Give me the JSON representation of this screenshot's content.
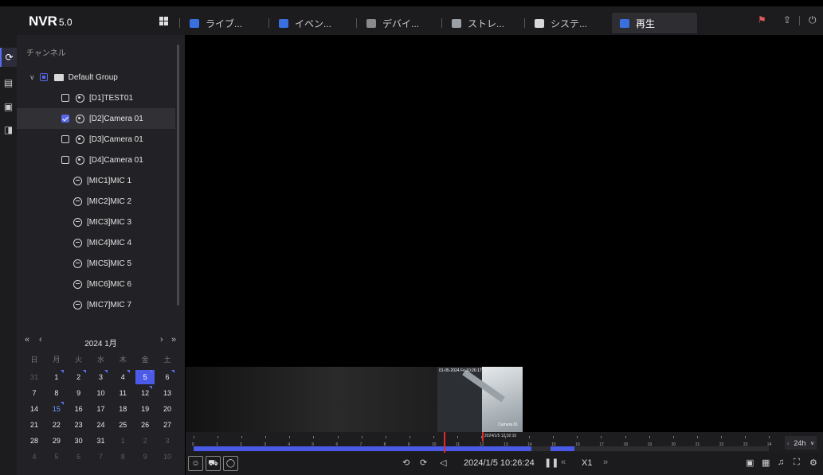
{
  "app": {
    "logo": "NVR",
    "version": "5.0"
  },
  "tabs": [
    {
      "label": "ライブ...",
      "icon": "live-view-icon",
      "color": "#3a6fe0"
    },
    {
      "label": "イベン...",
      "icon": "event-icon",
      "color": "#3a6fe0"
    },
    {
      "label": "デバイ...",
      "icon": "device-camera-icon",
      "color": "#8a8a8a"
    },
    {
      "label": "ストレ...",
      "icon": "storage-icon",
      "color": "#9aa0a6"
    },
    {
      "label": "システ...",
      "icon": "gear-icon",
      "color": "#d8d8d8"
    },
    {
      "label": "再生",
      "icon": "playback-icon",
      "color": "#3a6fe0",
      "active": true
    }
  ],
  "channel_panel": {
    "title": "チャンネル",
    "group": "Default Group",
    "channels": [
      {
        "label": "[D1]TEST01",
        "checked": false
      },
      {
        "label": "[D2]Camera 01",
        "checked": true
      },
      {
        "label": "[D3]Camera 01",
        "checked": false
      },
      {
        "label": "[D4]Camera 01",
        "checked": false
      }
    ],
    "mics": [
      "[MIC1]MIC 1",
      "[MIC2]MIC 2",
      "[MIC3]MIC 3",
      "[MIC4]MIC 4",
      "[MIC5]MIC 5",
      "[MIC6]MIC 6",
      "[MIC7]MIC 7"
    ]
  },
  "calendar": {
    "title": "2024 1月",
    "weekdays": [
      "日",
      "月",
      "火",
      "水",
      "木",
      "金",
      "土"
    ],
    "weeks": [
      [
        "31",
        "1",
        "2",
        "3",
        "4",
        "5",
        "6"
      ],
      [
        "7",
        "8",
        "9",
        "10",
        "11",
        "12",
        "13"
      ],
      [
        "14",
        "15",
        "16",
        "17",
        "18",
        "19",
        "20"
      ],
      [
        "21",
        "22",
        "23",
        "24",
        "25",
        "26",
        "27"
      ],
      [
        "28",
        "29",
        "30",
        "31",
        "1",
        "2",
        "3"
      ],
      [
        "4",
        "5",
        "6",
        "7",
        "8",
        "9",
        "10"
      ]
    ],
    "selected_day": "5",
    "current_day": "15",
    "recorded_days": [
      "1",
      "2",
      "3",
      "4",
      "5",
      "6",
      "12",
      "15"
    ]
  },
  "preview": {
    "osd": "01-05-2024 Fri 10:26:17",
    "camera_label": "Camera 01"
  },
  "timeline": {
    "hours": [
      "0",
      "1",
      "2",
      "3",
      "4",
      "5",
      "6",
      "7",
      "8",
      "9",
      "10",
      "11",
      "12",
      "13",
      "14",
      "15",
      "16",
      "17",
      "18",
      "19",
      "20",
      "21",
      "22",
      "23",
      "24"
    ],
    "recorded_ranges": [
      [
        0,
        14.1
      ],
      [
        14.9,
        15.9
      ]
    ],
    "cursor_hour": 10.45,
    "hover_hour": 12.03,
    "hover_time": "2024/1/5 12:02:10",
    "range_label": "24h"
  },
  "toolbar": {
    "time": "2024/1/5 10:26:24",
    "speed": "X1",
    "skip_back_label": "30s",
    "skip_fwd_label": "30s"
  }
}
